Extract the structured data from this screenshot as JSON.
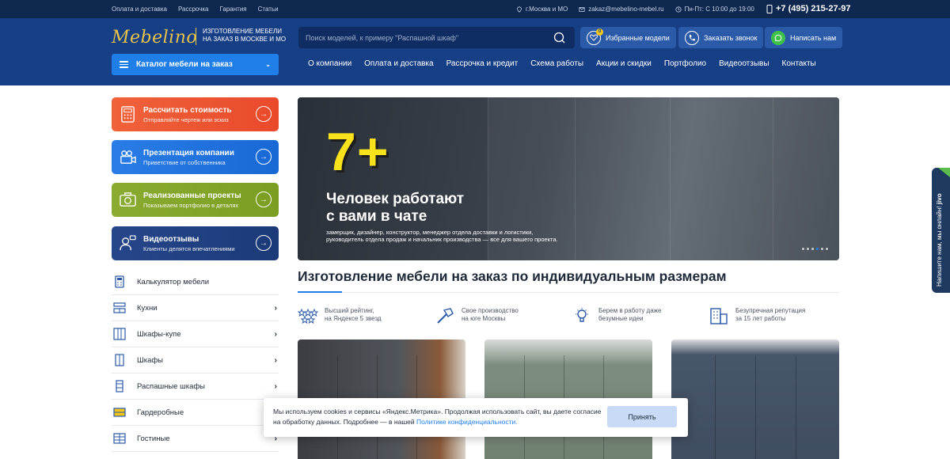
{
  "topbar": {
    "links": [
      "Оплата и доставка",
      "Рассрочка",
      "Гарантия",
      "Статьи"
    ],
    "location": "г.Москва и МО",
    "email": "zakaz@mebelino-mebel.ru",
    "hours": "Пн-Пт: С 10:00 до 19:00",
    "phone": "+7 (495) 215-27-97"
  },
  "header": {
    "logo": "Mebelino",
    "tagline_1": "ИЗГОТОВЛЕНИЕ МЕБЕЛИ",
    "tagline_2": "НА ЗАКАЗ В МОСКВЕ И МО",
    "search_placeholder": "Поиск моделей, к примеру \"Распашной шкаф\"",
    "favorites_label": "Избранные модели",
    "favorites_count": "0",
    "callback_label": "Заказать звонок",
    "whatsapp_label": "Написать нам",
    "catalog_label": "Каталог мебели на заказ"
  },
  "nav": [
    "О компании",
    "Оплата и доставка",
    "Рассрочка и кредит",
    "Схема работы",
    "Акции и скидки",
    "Портфолио",
    "Видеоотзывы",
    "Контакты"
  ],
  "cards": [
    {
      "title": "Рассчитать стоимость",
      "subtitle": "Отправляйте чертеж или эскиз"
    },
    {
      "title": "Презентация компании",
      "subtitle": "Приветствие от собственника"
    },
    {
      "title": "Реализованные проекты",
      "subtitle": "Показываем портфолио в деталях"
    },
    {
      "title": "Видеоотзывы",
      "subtitle": "Клиенты делятся впечатлениями"
    }
  ],
  "catalog_list": [
    {
      "label": "Калькулятор мебели",
      "has_arrow": false
    },
    {
      "label": "Кухни",
      "has_arrow": true
    },
    {
      "label": "Шкафы-купе",
      "has_arrow": true
    },
    {
      "label": "Шкафы",
      "has_arrow": true
    },
    {
      "label": "Распашные шкафы",
      "has_arrow": true
    },
    {
      "label": "Гардеробные",
      "has_arrow": false
    },
    {
      "label": "Гостиные",
      "has_arrow": true
    }
  ],
  "banner": {
    "number": "7+",
    "title_1": "Человек работают",
    "title_2": "с вами в чате",
    "text": "замерщик, дизайнер, конструктор, менеджер отдела доставки и логистики, руководитель отдела продаж и начальник производства — все для вашего проекта.",
    "slide_count": 6,
    "active_slide": 3
  },
  "main_heading": "Изготовление мебели на заказ по индивидуальным размерам",
  "features": [
    {
      "line_1": "Высший рейтинг,",
      "line_2": "на Яндексе 5 звезд"
    },
    {
      "line_1": "Свое производство",
      "line_2": "на юге Москвы"
    },
    {
      "line_1": "Берем в работу даже",
      "line_2": "безумные идеи"
    },
    {
      "line_1": "Безупречная репутация",
      "line_2": "за 15 лет работы"
    }
  ],
  "cookie": {
    "text": "Мы используем cookies и сервисы «Яндекс.Метрика». Продолжая использовать сайт, вы даете согласие на обработку данных. Подробнее — в нашей ",
    "link": "Политике конфиденциальности.",
    "accept_label": "Принять"
  },
  "jivo": {
    "label": "Напишите нам, мы онлайн!",
    "brand": "jivo"
  },
  "colors": {
    "brand": "#173f86",
    "accent": "#1f7ee8",
    "gold": "#e8c34a",
    "yellow": "#f7e21c"
  }
}
